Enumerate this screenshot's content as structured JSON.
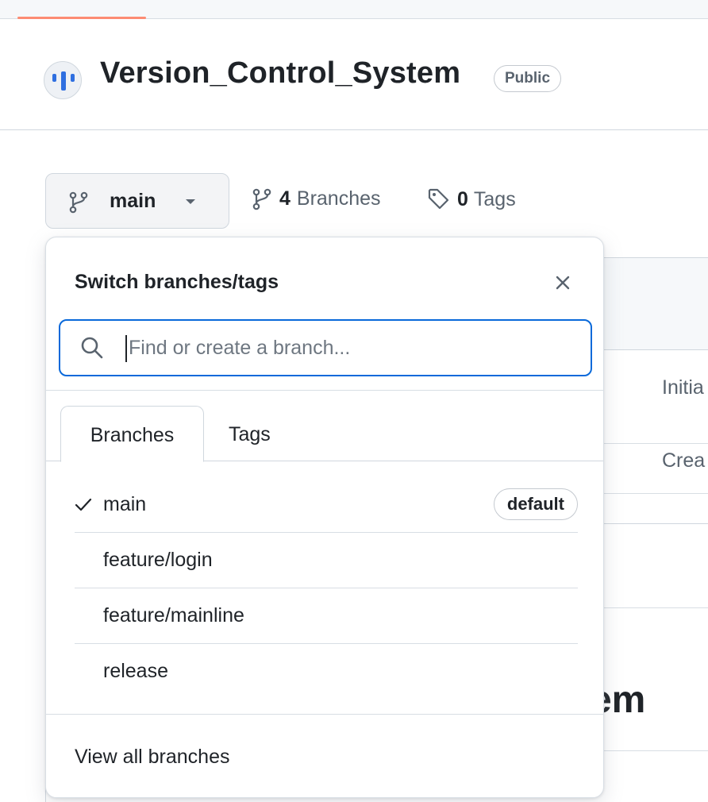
{
  "repo": {
    "name": "Version_Control_System",
    "visibility": "Public"
  },
  "branch_selector": {
    "current": "main",
    "branches_count": "4",
    "branches_label": "Branches",
    "tags_count": "0",
    "tags_label": "Tags"
  },
  "background": {
    "commit_1": "Initia",
    "commit_2": "Crea",
    "readme_heading": "tem"
  },
  "dropdown": {
    "title": "Switch branches/tags",
    "search_placeholder": "Find or create a branch...",
    "search_value": "",
    "tabs": [
      {
        "label": "Branches",
        "active": true
      },
      {
        "label": "Tags",
        "active": false
      }
    ],
    "branches": [
      {
        "name": "main",
        "selected": true,
        "badge": "default"
      },
      {
        "name": "feature/login",
        "selected": false
      },
      {
        "name": "feature/mainline",
        "selected": false
      },
      {
        "name": "release",
        "selected": false
      }
    ],
    "footer_link": "View all branches"
  },
  "colors": {
    "accent": "#0969da",
    "nav_underline": "#fd8c73"
  },
  "icons": {
    "branch": "git-branch-icon",
    "tag": "tag-icon",
    "search": "search-icon",
    "close": "close-icon",
    "check": "check-icon",
    "caret": "triangle-down-icon"
  }
}
